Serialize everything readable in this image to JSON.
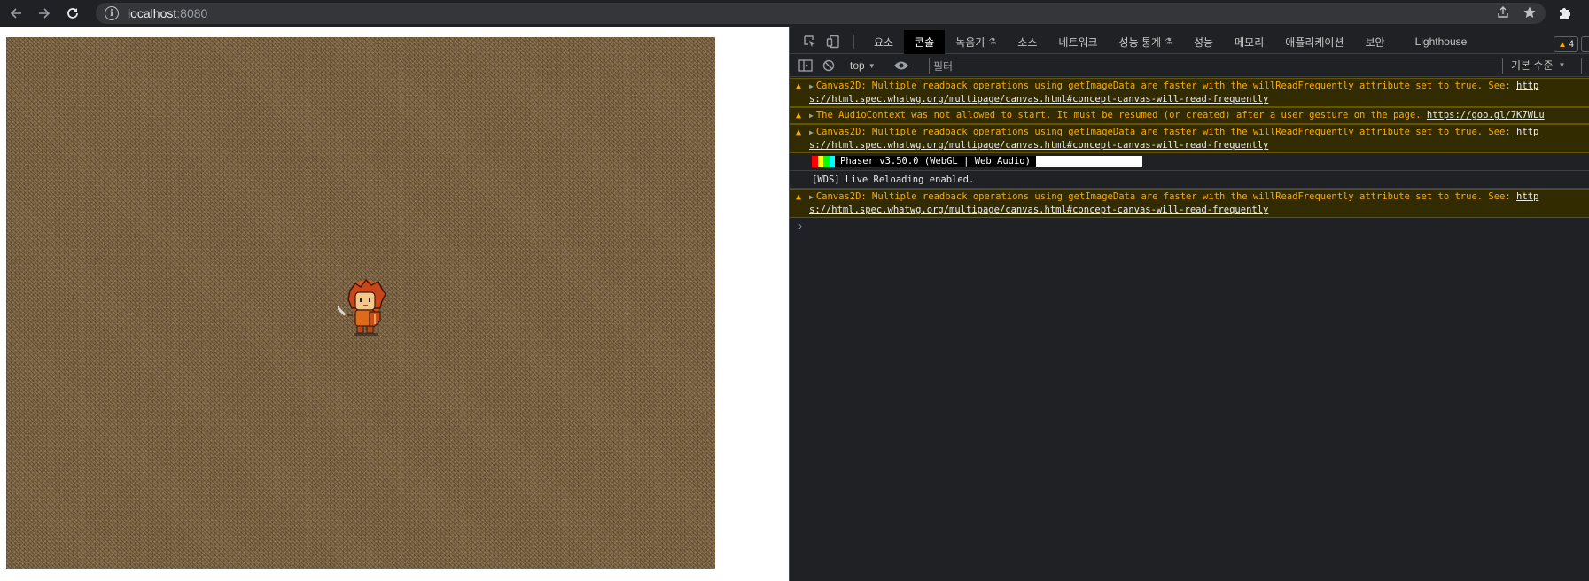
{
  "browser": {
    "url_host": "localhost",
    "url_port": ":8080"
  },
  "devtools": {
    "tabs": [
      {
        "label": "요소"
      },
      {
        "label": "콘솔"
      },
      {
        "label": "녹음기"
      },
      {
        "label": "소스"
      },
      {
        "label": "네트워크"
      },
      {
        "label": "성능 통계"
      },
      {
        "label": "성능"
      },
      {
        "label": "메모리"
      },
      {
        "label": "애플리케이션"
      },
      {
        "label": "보안"
      },
      {
        "label": "Lighthouse"
      }
    ],
    "selected_tab": "콘솔",
    "warning_count": "4",
    "context": "top",
    "filter_placeholder": "필터",
    "level": "기본 수준",
    "messages": {
      "m1_text": "Canvas2D: Multiple readback operations using getImageData are faster with the willReadFrequently attribute set to true. See: ",
      "m1_link_a": "http",
      "m1_link_b": "s://html.spec.whatwg.org/multipage/canvas.html#concept-canvas-will-read-frequently",
      "m2_text": "The AudioContext was not allowed to start. It must be resumed (or created) after a user gesture on the page. ",
      "m2_link": "https://goo.gl/7K7WLu",
      "m3_text": "Canvas2D: Multiple readback operations using getImageData are faster with the willReadFrequently attribute set to true. See: ",
      "m3_link_a": "http",
      "m3_link_b": "s://html.spec.whatwg.org/multipage/canvas.html#concept-canvas-will-read-frequently",
      "phaser": "Phaser v3.50.0 (WebGL | Web Audio)",
      "wds": "[WDS] Live Reloading enabled.",
      "m5_text": "Canvas2D: Multiple readback operations using getImageData are faster with the willReadFrequently attribute set to true. See: ",
      "m5_link_a": "http",
      "m5_link_b": "s://html.spec.whatwg.org/multipage/canvas.html#concept-canvas-will-read-frequently"
    },
    "prompt_symbol": "›"
  },
  "colors": {
    "warning": "#f9ab00",
    "ground": "#7d6546",
    "hero_hair": "#d9541a"
  }
}
